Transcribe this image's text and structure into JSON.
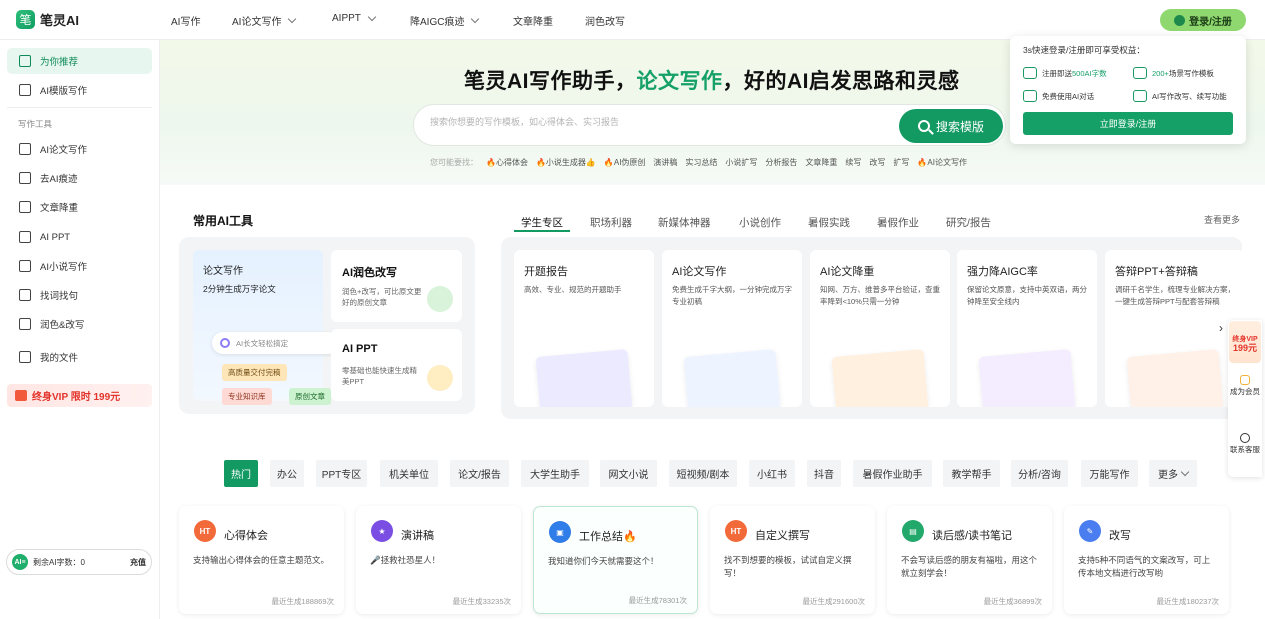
{
  "app": {
    "logo_text": "笔灵AI",
    "logo_mark": "笔"
  },
  "nav": {
    "items": [
      {
        "label": "AI写作"
      },
      {
        "label": "AI论文写作"
      },
      {
        "label": "AIPPT"
      },
      {
        "label": "降AIGC痕迹"
      },
      {
        "label": "文章降重"
      },
      {
        "label": "润色改写"
      }
    ],
    "login": "登录/注册"
  },
  "sidebar": {
    "items": [
      {
        "label": "为你推荐"
      },
      {
        "label": "AI模版写作"
      }
    ],
    "section": "写作工具",
    "tools": [
      {
        "label": "AI论文写作"
      },
      {
        "label": "去AI痕迹"
      },
      {
        "label": "文章降重"
      },
      {
        "label": "AI PPT"
      },
      {
        "label": "AI小说写作"
      },
      {
        "label": "找词找句"
      },
      {
        "label": "润色&改写"
      },
      {
        "label": "我的文件"
      }
    ],
    "vip": "终身VIP 限时 199元",
    "quota": {
      "badge": "AI≡",
      "label": "剩余AI字数：0",
      "charge": "充值"
    }
  },
  "hero": {
    "title_a": "笔灵AI写作助手，",
    "title_hl": "论文写作",
    "title_b": "，好的AI启发思路和灵感",
    "search_placeholder": "搜索你想要的写作模板，如心得体会、实习报告",
    "search_button": "搜索模版",
    "tags_label": "您可能要找：",
    "tags": [
      "🔥心得体会",
      "🔥小说生成器👍",
      "🔥AI伪原创",
      "演讲稿",
      "实习总结",
      "小说扩写",
      "分析报告",
      "文章降重",
      "续写",
      "改写",
      "扩写",
      "🔥AI论文写作"
    ]
  },
  "popover": {
    "title": "3s快速登录/注册即可享受权益：",
    "perks": [
      {
        "pre": "注册即送",
        "em": "500AI字数",
        "post": ""
      },
      {
        "pre": "",
        "em": "200+",
        "post": "场景写作模板"
      },
      {
        "pre": "免费使用AI对话",
        "em": "",
        "post": ""
      },
      {
        "pre": "AI写作改写、续写功能",
        "em": "",
        "post": ""
      }
    ],
    "button": "立即登录/注册"
  },
  "tools": {
    "title": "常用AI工具",
    "big": {
      "title": "论文写作",
      "sub": "2分钟生成万字论文",
      "pill": "AI长文轻松搞定",
      "tags": [
        "高质量交付完稿",
        "专业知识库",
        "原创文章"
      ]
    },
    "small": [
      {
        "title": "AI润色改写",
        "desc": "润色+改写，可比原文更好的原创文章"
      },
      {
        "title": "AI PPT",
        "desc": "零基础也能快速生成精美PPT"
      }
    ]
  },
  "categories": {
    "tabs": [
      "学生专区",
      "职场利器",
      "新媒体神器",
      "小说创作",
      "暑假实践",
      "暑假作业",
      "研究/报告"
    ],
    "view_more": "查看更多"
  },
  "cards": [
    {
      "title": "开题报告",
      "desc": "高效、专业、规范的开题助手"
    },
    {
      "title": "AI论文写作",
      "desc": "免费生成千字大纲，一分钟完成万字专业初稿"
    },
    {
      "title": "AI论文降重",
      "desc": "知网、万方、维普多平台验证，查重率降到<10%只需一分钟"
    },
    {
      "title": "强力降AIGC率",
      "desc": "保留论文原意，支持中英双语，两分钟降至安全线内"
    },
    {
      "title": "答辩PPT+答辩稿",
      "desc": "调研千名学生，梳理专业解决方案，一键生成答辩PPT与配套答辩稿"
    }
  ],
  "float_bar": {
    "vip_line1": "终身VIP",
    "vip_price": "199元",
    "member": "成为会员",
    "support": "联系客服"
  },
  "pills": [
    "热门",
    "办公",
    "PPT专区",
    "机关单位",
    "论文/报告",
    "大学生助手",
    "网文小说",
    "短视频/剧本",
    "小红书",
    "抖音",
    "暑假作业助手",
    "教学帮手",
    "分析/咨询",
    "万能写作",
    "更多"
  ],
  "templates": [
    {
      "title": "心得体会",
      "desc": "支持输出心得体会的任意主题范文。",
      "meta": "最近生成188869次",
      "icon": "HT",
      "color": "#f26a3a"
    },
    {
      "title": "演讲稿",
      "desc": "🎤拯救社恐星人！",
      "meta": "最近生成33235次",
      "icon": "★",
      "color": "#7b4ee3"
    },
    {
      "title": "工作总结🔥",
      "desc": "我知道你们今天就需要这个！",
      "meta": "最近生成78301次",
      "icon": "▣",
      "color": "#2f7de8"
    },
    {
      "title": "自定义撰写",
      "desc": "找不到想要的模板，试试自定义撰写！",
      "meta": "最近生成291600次",
      "icon": "HT",
      "color": "#f26a3a"
    },
    {
      "title": "读后感/读书笔记",
      "desc": "不会写读后感的朋友有福啦，用这个就立刻学会！",
      "meta": "最近生成36899次",
      "icon": "▤",
      "color": "#22a86a"
    },
    {
      "title": "改写",
      "desc": "支持5种不同语气的文案改写，可上传本地文档进行改写哟",
      "meta": "最近生成180237次",
      "icon": "✎",
      "color": "#4a7df0"
    }
  ]
}
